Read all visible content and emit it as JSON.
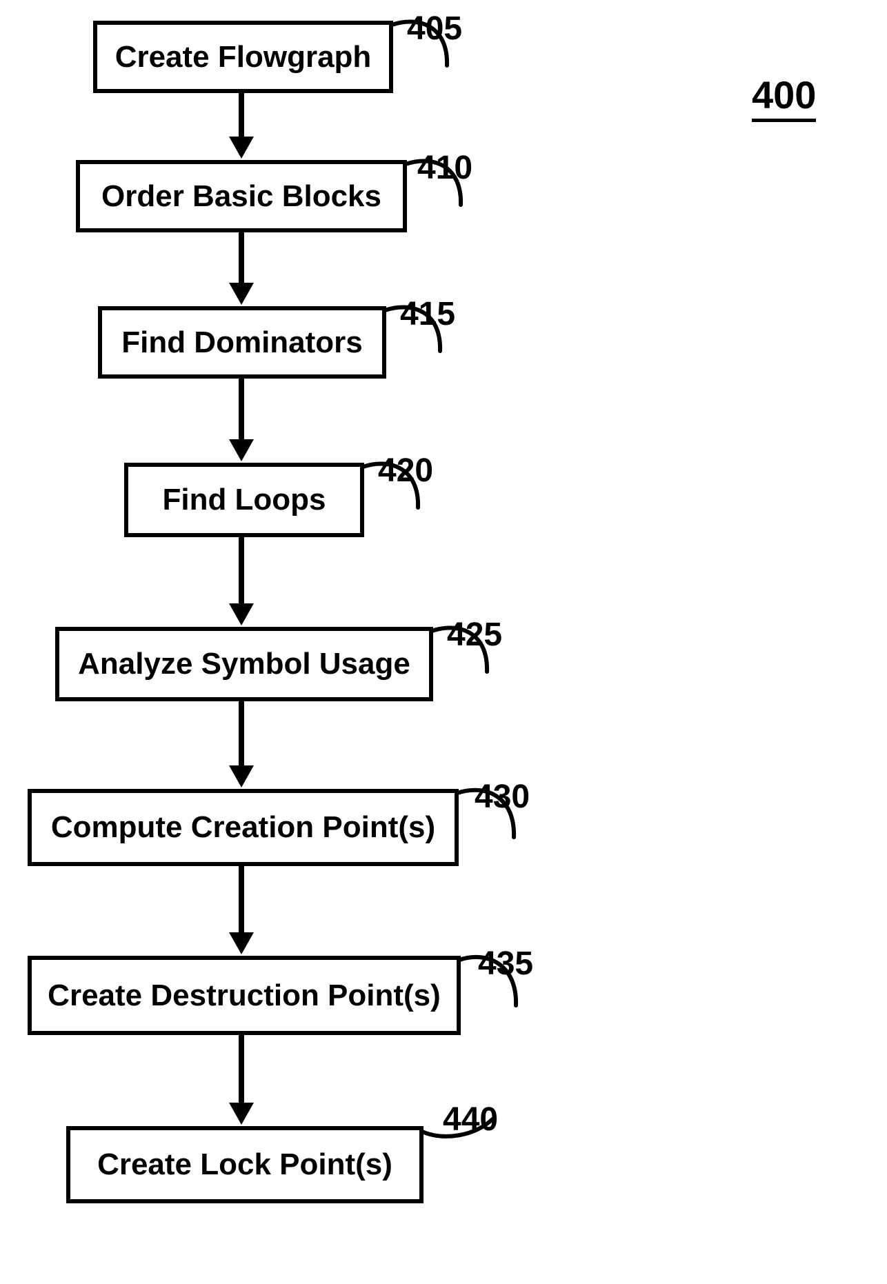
{
  "figure_label": "400",
  "steps": [
    {
      "id": "s405",
      "ref": "405",
      "text": "Create Flowgraph"
    },
    {
      "id": "s410",
      "ref": "410",
      "text": "Order Basic Blocks"
    },
    {
      "id": "s415",
      "ref": "415",
      "text": "Find Dominators"
    },
    {
      "id": "s420",
      "ref": "420",
      "text": "Find Loops"
    },
    {
      "id": "s425",
      "ref": "425",
      "text": "Analyze Symbol Usage"
    },
    {
      "id": "s430",
      "ref": "430",
      "text": "Compute Creation Point(s)"
    },
    {
      "id": "s435",
      "ref": "435",
      "text": "Create Destruction Point(s)"
    },
    {
      "id": "s440",
      "ref": "440",
      "text": "Create Lock Point(s)"
    }
  ]
}
